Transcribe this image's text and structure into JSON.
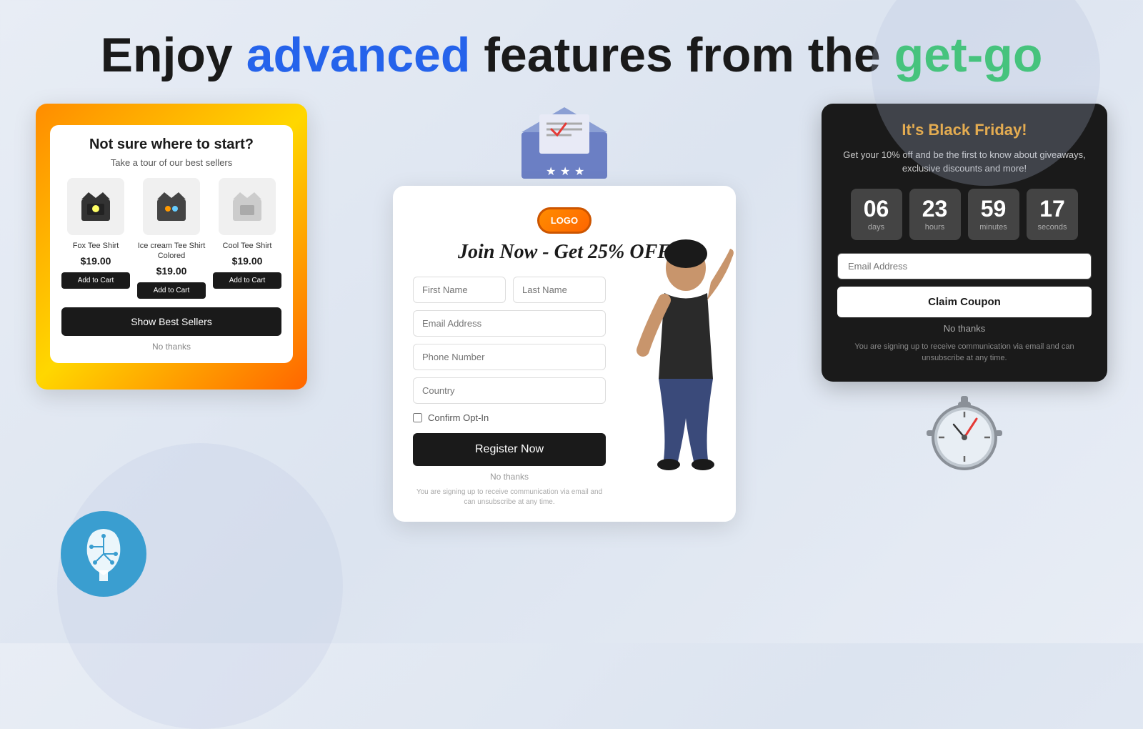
{
  "header": {
    "text_part1": "Enjoy ",
    "text_advanced": "advanced",
    "text_part2": " features from the ",
    "text_getgo": "get-go"
  },
  "product_widget": {
    "title": "Not sure where to start?",
    "subtitle": "Take a tour of our best sellers",
    "products": [
      {
        "name": "Fox Tee Shirt",
        "price": "$19.00",
        "emoji": "👕"
      },
      {
        "name": "Ice cream Tee Shirt Colored",
        "price": "$19.00",
        "emoji": "👕"
      },
      {
        "name": "Cool Tee Shirt",
        "price": "$19.00",
        "emoji": "👕"
      }
    ],
    "add_to_cart_label": "Add to Cart",
    "show_best_sellers_label": "Show Best Sellers",
    "no_thanks_label": "No thanks"
  },
  "form_widget": {
    "logo_label": "LOGO",
    "title": "Join Now - Get 25% OFF",
    "first_name_placeholder": "First Name",
    "last_name_placeholder": "Last Name",
    "email_placeholder": "Email Address",
    "phone_placeholder": "Phone Number",
    "country_placeholder": "Country",
    "confirm_optin_label": "Confirm Opt-In",
    "register_label": "Register Now",
    "no_thanks_label": "No thanks",
    "disclaimer": "You are signing up to receive communication via email and can unsubscribe at any time."
  },
  "black_friday_widget": {
    "title": "It's Black Friday!",
    "subtitle": "Get your 10% off and be the first to know about giveaways, exclusive discounts and more!",
    "countdown": {
      "days": {
        "value": "06",
        "label": "days"
      },
      "hours": {
        "value": "23",
        "label": "hours"
      },
      "minutes": {
        "value": "59",
        "label": "minutes"
      },
      "seconds": {
        "value": "17",
        "label": "seconds"
      }
    },
    "email_placeholder": "Email Address",
    "claim_label": "Claim Coupon",
    "no_thanks_label": "No thanks",
    "disclaimer": "You are signing up to receive communication via email and can unsubscribe at any time."
  }
}
